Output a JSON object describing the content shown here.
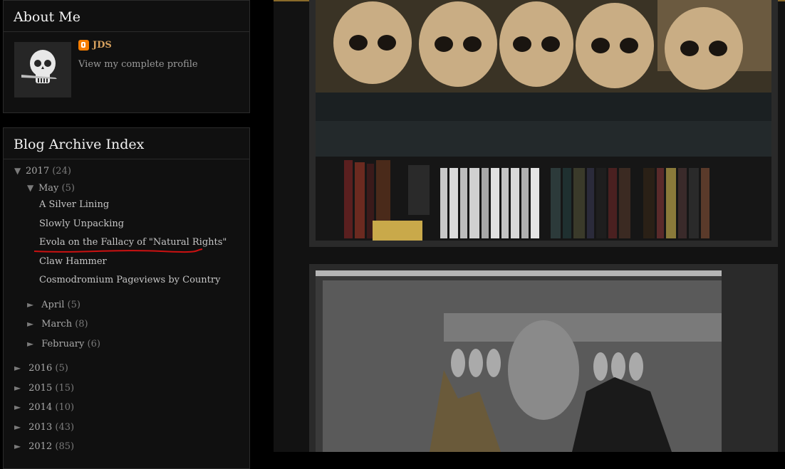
{
  "about": {
    "title": "About Me",
    "author_name": "JDS",
    "profile_link": "View my complete profile",
    "icon": "blogger-icon"
  },
  "archive": {
    "title": "Blog Archive Index",
    "years": [
      {
        "label": "2017",
        "count": "(24)",
        "expanded": true
      },
      {
        "label": "2016",
        "count": "(5)",
        "expanded": false
      },
      {
        "label": "2015",
        "count": "(15)",
        "expanded": false
      },
      {
        "label": "2014",
        "count": "(10)",
        "expanded": false
      },
      {
        "label": "2013",
        "count": "(43)",
        "expanded": false
      },
      {
        "label": "2012",
        "count": "(85)",
        "expanded": false
      }
    ],
    "months": [
      {
        "label": "May",
        "count": "(5)",
        "expanded": true
      },
      {
        "label": "April",
        "count": "(5)",
        "expanded": false
      },
      {
        "label": "March",
        "count": "(8)",
        "expanded": false
      },
      {
        "label": "February",
        "count": "(6)",
        "expanded": false
      }
    ],
    "posts": [
      "A Silver Lining",
      "Slowly Unpacking",
      "Evola on the Fallacy of \"Natural Rights\"",
      "Claw Hammer",
      "Cosmodromium Pageviews by Country"
    ],
    "expanded_glyph": "▼",
    "collapsed_glyph": "►"
  },
  "colors": {
    "accent_link": "#d6a15e",
    "annotation": "#cc1111",
    "background": "#000000"
  }
}
